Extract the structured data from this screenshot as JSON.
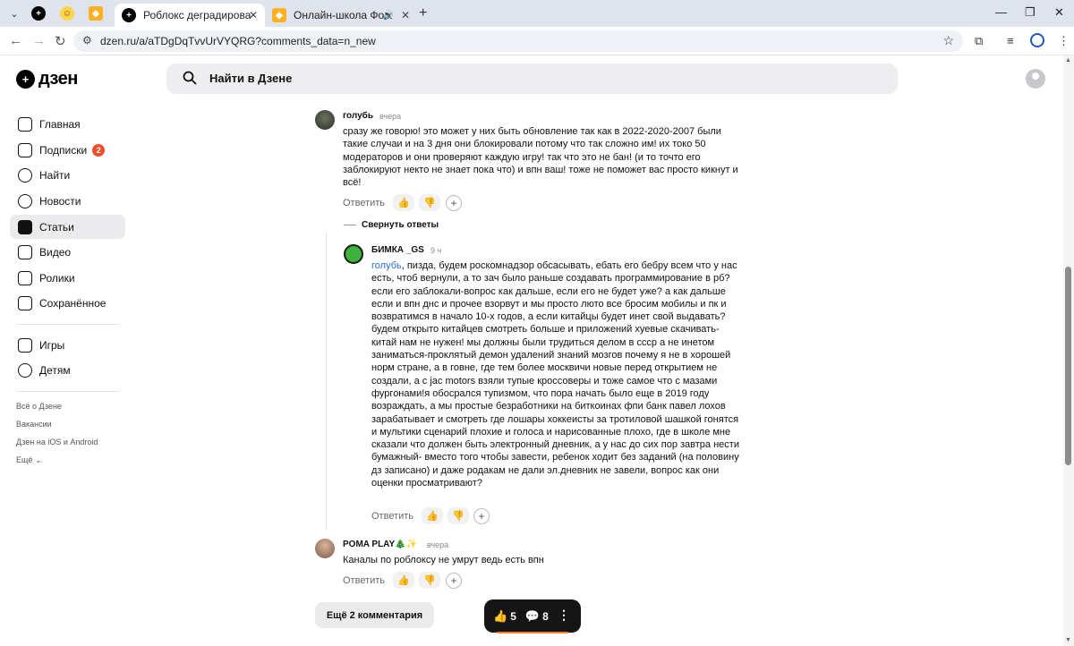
{
  "browser": {
    "tabs": [
      {
        "title": "Роблокс деградировал! | MAT",
        "active": true
      },
      {
        "title": "Онлайн-школа Фоксфорд",
        "active": false
      }
    ],
    "url": "dzen.ru/a/aTDgDqTvvUrVYQRG?comments_data=n_new"
  },
  "header": {
    "logo_text": "дзен",
    "search_placeholder": "Найти в Дзене"
  },
  "sidebar": {
    "items": [
      {
        "label": "Главная",
        "icon": "home-icon"
      },
      {
        "label": "Подписки",
        "icon": "subscriptions-icon",
        "badge": "2"
      },
      {
        "label": "Найти",
        "icon": "search-icon"
      },
      {
        "label": "Новости",
        "icon": "news-icon"
      },
      {
        "label": "Статьи",
        "icon": "articles-icon",
        "active": true
      },
      {
        "label": "Видео",
        "icon": "video-icon"
      },
      {
        "label": "Ролики",
        "icon": "shorts-icon"
      },
      {
        "label": "Сохранённое",
        "icon": "bookmark-icon"
      },
      {
        "label": "Игры",
        "icon": "games-icon"
      },
      {
        "label": "Детям",
        "icon": "kids-icon"
      }
    ],
    "links": [
      "Всё о Дзене",
      "Вакансии",
      "Дзен на iOS и Android",
      "Ещё"
    ]
  },
  "comments": [
    {
      "author": "голубь",
      "time": "вчера",
      "text": "сразу же говорю! это может у них быть обновление так как в 2022-2020-2007 были такие случаи и на 3 дня они блокировали потому что так сложно им! их токо 50 модераторов и они проверяют каждую игру! так что это не бан! (и то точто его заблокируют некто не знает пока что) и впн ваш! тоже не поможет вас просто кикнут и всё!"
    },
    {
      "author": "БИМКА _GS",
      "time": "9 ч",
      "mention": "голубь",
      "text": ", пизда, будем роскомнадзор обсасывать, ебать его бебру всем что у нас есть, чтоб вернули, а то зач было раньше создавать программирование в рб? если его заблокали-вопрос как дальше, если его не будет уже? а как дальше если и впн днс и прочее взорвут и мы просто люто все бросим мобилы и пк и возвратимся в начало 10-х годов, а если китайцы будет инет свой выдавать? будем открыто китайцев смотреть больше и приложений хуевые скачивать-китай нам не нужен! мы должны были трудиться делом в ссср а не инетом заниматься-проклятый демон удалений знаний мозгов почему я не в хорошей норм стране, а в говне, где тем более москвичи новые перед открытием не создали, а с jac motors взяли тупые кроссоверы и тоже самое что с мазами фургонами!я обосрался тупизмом, что пора начать было еще в 2019 году возраждать, а мы простые безработники на биткоинах фпи банк павел лохов зарабатывает и смотреть где лошары хоккеисты за тротиловой шашкой гонятся и мультики сценарий плохие и голоса и нарисованные плохо, где в школе мне сказали что должен быть электронный дневник, а у нас до сих пор завтра нести бумажный- вместо того чтобы завести, ребенок ходит без заданий (на половину дз записано) и даже родакам не дали эл.дневник не завели, вопрос как они оценки просматривают?"
    },
    {
      "author": "POMA PLAY🎄✨",
      "time": "вчера",
      "text": "Каналы по роблоксу не умрут ведь есть впн"
    }
  ],
  "actions": {
    "reply": "Ответить",
    "like": "👍",
    "dislike": "👎",
    "add": "+",
    "collapse_replies": "Свернуть ответы",
    "more_comments": "Ещё 2 комментария"
  },
  "floating_bar": {
    "likes": "5",
    "comments": "8"
  }
}
